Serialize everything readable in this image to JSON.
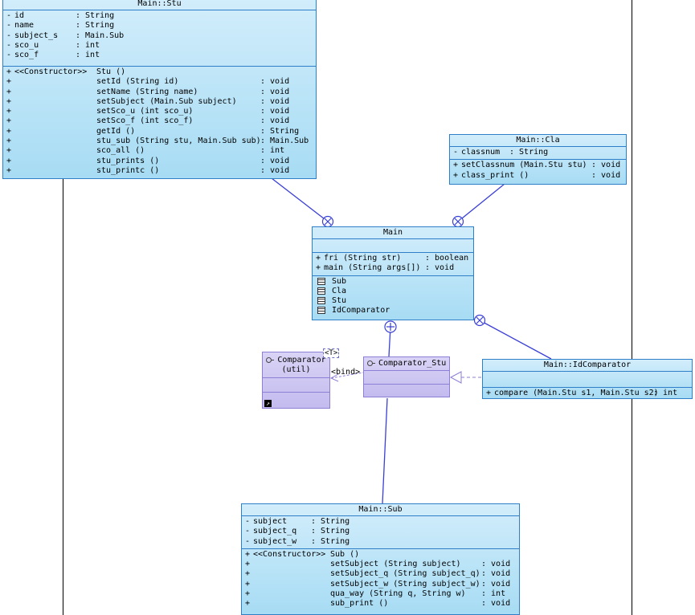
{
  "classes": {
    "stu": {
      "title": "Main::Stu",
      "attributes": [
        {
          "vis": "-",
          "name": "id",
          "type": ": String"
        },
        {
          "vis": "-",
          "name": "name",
          "type": ": String"
        },
        {
          "vis": "-",
          "name": "subject_s",
          "type": ": Main.Sub"
        },
        {
          "vis": "-",
          "name": "sco_u",
          "type": ": int"
        },
        {
          "vis": "-",
          "name": "sco_f",
          "type": ": int"
        }
      ],
      "operations": [
        {
          "vis": "+",
          "stereo": "<<Constructor>>",
          "sig": "Stu ()",
          "ret": ""
        },
        {
          "vis": "+",
          "stereo": "",
          "sig": "setId (String id)",
          "ret": ": void"
        },
        {
          "vis": "+",
          "stereo": "",
          "sig": "setName (String name)",
          "ret": ": void"
        },
        {
          "vis": "+",
          "stereo": "",
          "sig": "setSubject (Main.Sub subject)",
          "ret": ": void"
        },
        {
          "vis": "+",
          "stereo": "",
          "sig": "setSco_u (int sco_u)",
          "ret": ": void"
        },
        {
          "vis": "+",
          "stereo": "",
          "sig": "setSco_f (int sco_f)",
          "ret": ": void"
        },
        {
          "vis": "+",
          "stereo": "",
          "sig": "getId ()",
          "ret": ": String"
        },
        {
          "vis": "+",
          "stereo": "",
          "sig": "stu_sub (String stu, Main.Sub sub)",
          "ret": ": Main.Sub"
        },
        {
          "vis": "+",
          "stereo": "",
          "sig": "sco_all ()",
          "ret": ": int"
        },
        {
          "vis": "+",
          "stereo": "",
          "sig": "stu_prints ()",
          "ret": ": void"
        },
        {
          "vis": "+",
          "stereo": "",
          "sig": "stu_printc ()",
          "ret": ": void"
        }
      ]
    },
    "cla": {
      "title": "Main::Cla",
      "attributes": [
        {
          "vis": "-",
          "name": "classnum",
          "type": ": String"
        }
      ],
      "operations": [
        {
          "vis": "+",
          "sig": "setClassnum (Main.Stu stu)",
          "ret": ": void"
        },
        {
          "vis": "+",
          "sig": "class_print ()",
          "ret": ": void"
        }
      ]
    },
    "main": {
      "title": "Main",
      "operations": [
        {
          "vis": "+",
          "sig": "fri (String str)",
          "ret": ": boolean"
        },
        {
          "vis": "+",
          "sig": "main (String args[])",
          "ret": ": void"
        }
      ],
      "nested": [
        "Sub",
        "Cla",
        "Stu",
        "IdComparator"
      ]
    },
    "comparator": {
      "name": "Comparator",
      "package": "(util)",
      "type_param": "<T>"
    },
    "comparator_stu": {
      "name": "Comparator_Stu"
    },
    "idcomparator": {
      "title": "Main::IdComparator",
      "operations": [
        {
          "vis": "+",
          "sig": "compare (Main.Stu s1, Main.Stu s2)",
          "ret": ": int"
        }
      ]
    },
    "sub": {
      "title": "Main::Sub",
      "attributes": [
        {
          "vis": "-",
          "name": "subject",
          "type": ": String"
        },
        {
          "vis": "-",
          "name": "subject_q",
          "type": ": String"
        },
        {
          "vis": "-",
          "name": "subject_w",
          "type": ": String"
        }
      ],
      "operations": [
        {
          "vis": "+",
          "stereo": "<<Constructor>>",
          "sig": "Sub ()",
          "ret": ""
        },
        {
          "vis": "+",
          "stereo": "",
          "sig": "setSubject (String subject)",
          "ret": ": void"
        },
        {
          "vis": "+",
          "stereo": "",
          "sig": "setSubject_q (String subject_q)",
          "ret": ": void"
        },
        {
          "vis": "+",
          "stereo": "",
          "sig": "setSubject_w (String subject_w)",
          "ret": ": void"
        },
        {
          "vis": "+",
          "stereo": "",
          "sig": "qua_way (String q, String w)",
          "ret": ": int"
        },
        {
          "vis": "+",
          "stereo": "",
          "sig": "sub_print ()",
          "ret": ": void"
        }
      ]
    }
  },
  "connectors": {
    "bind_label": "<bind>"
  },
  "colors": {
    "class_border": "#2e7fc7",
    "class_fill": "#b8e3f7",
    "interface_border": "#8b7fd6",
    "connector": "#3a3fd6"
  }
}
